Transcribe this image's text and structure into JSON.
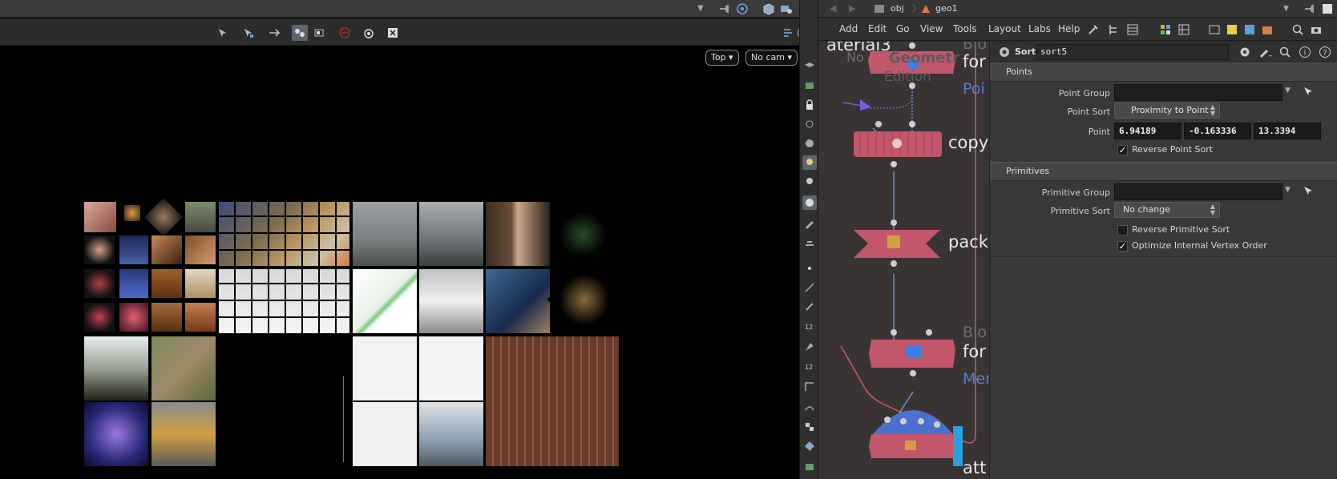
{
  "viewport": {
    "view_button": "Top ▾",
    "camera_button": "No cam ▾"
  },
  "path_bar": {
    "level1": "obj",
    "level2": "geo1"
  },
  "menu": {
    "items": [
      "Add",
      "Edit",
      "Go",
      "View",
      "Tools",
      "Layout",
      "Labs",
      "Help"
    ]
  },
  "network": {
    "labels": {
      "material": "aterial3",
      "block_top_partial": "Blo",
      "for_top": "for",
      "node_sub_no": "No",
      "geometry_partial": "Geometr",
      "edition": "Edition",
      "poi": "Poi",
      "copy": "copy",
      "pack": "pack",
      "block_bottom_partial": "Blo",
      "for_bottom": "for",
      "mer": "Mer",
      "att": "att"
    }
  },
  "params": {
    "node_type": "Sort",
    "node_name": "sort5",
    "points_section": "Points",
    "point_group_label": "Point Group",
    "point_group_value": "",
    "point_sort_label": "Point Sort",
    "point_sort_value": "Proximity to Point",
    "point_label": "Point",
    "point_x": "6.94189",
    "point_y": "-0.163336",
    "point_z": "13.3394",
    "reverse_point_sort_label": "Reverse Point Sort",
    "reverse_point_sort_checked": true,
    "primitives_section": "Primitives",
    "primitive_group_label": "Primitive Group",
    "primitive_group_value": "",
    "primitive_sort_label": "Primitive Sort",
    "primitive_sort_value": "No change",
    "reverse_primitive_sort_label": "Reverse Primitive Sort",
    "reverse_primitive_sort_checked": false,
    "optimize_vertex_order_label": "Optimize Internal Vertex Order",
    "optimize_vertex_order_checked": true
  },
  "colors": {
    "node_fill": "#c2566a",
    "network_bg": "#3a3334",
    "wire_blue": "#7aa6e0",
    "param_bg": "#383838"
  }
}
